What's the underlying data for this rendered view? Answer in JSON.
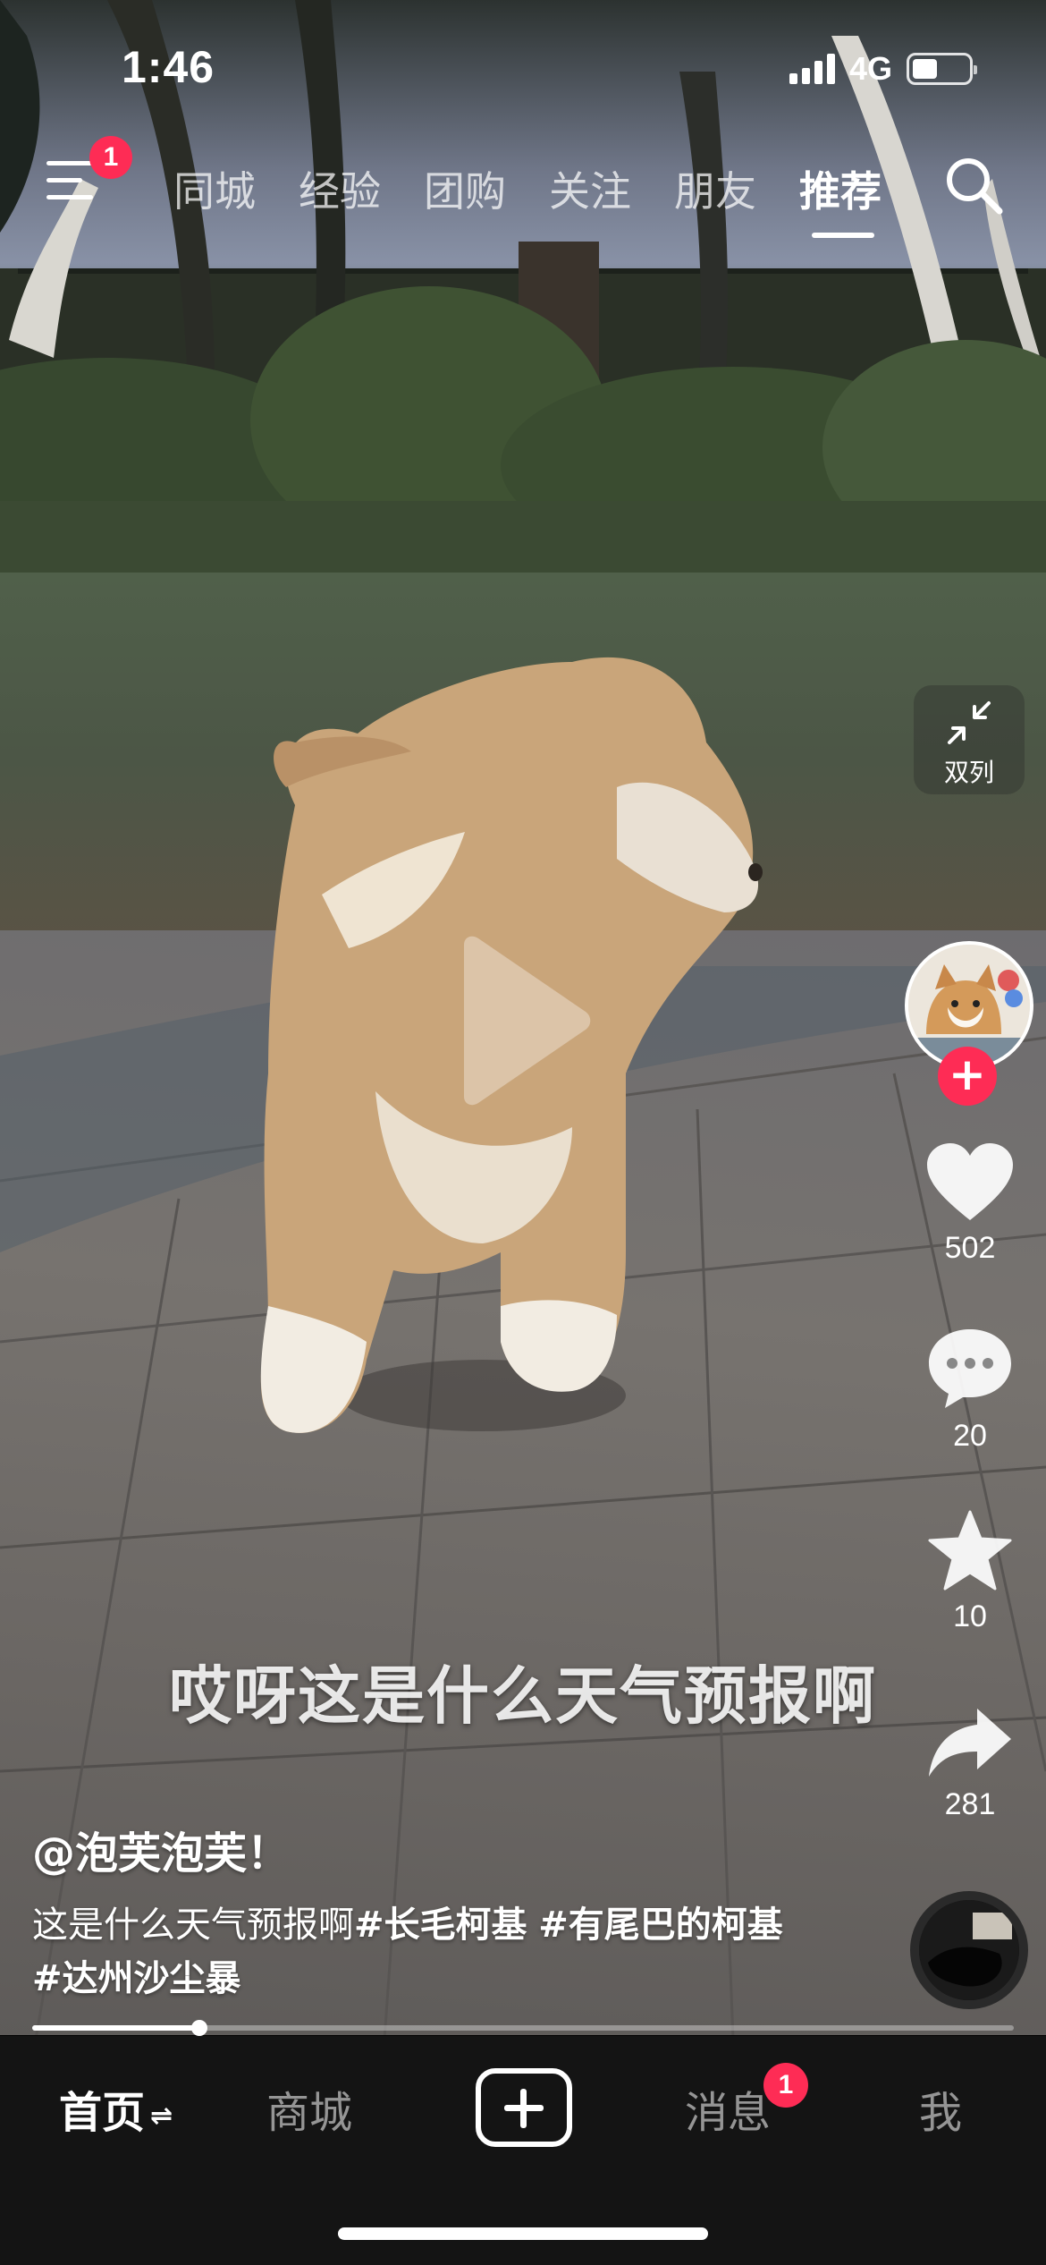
{
  "status_bar": {
    "time": "1:46",
    "network": "4G",
    "battery_level": 0.45
  },
  "top_nav": {
    "menu_badge": "1",
    "tabs": [
      {
        "label": "同城",
        "active": false
      },
      {
        "label": "经验",
        "active": false
      },
      {
        "label": "团购",
        "active": false
      },
      {
        "label": "关注",
        "active": false
      },
      {
        "label": "朋友",
        "active": false
      },
      {
        "label": "推荐",
        "active": true
      }
    ],
    "search_icon": "search-icon"
  },
  "right_rail": {
    "dual_column_label": "双列",
    "likes": "502",
    "comments": "20",
    "favorites": "10",
    "shares": "281"
  },
  "video": {
    "subtitle": "哎呀这是什么天气预报啊",
    "author": "@泡芙泡芙！",
    "caption_text": "这是什么天气预报啊",
    "hashtags": [
      "#长毛柯基",
      "#有尾巴的柯基",
      "#达州沙尘暴"
    ],
    "progress": 0.17
  },
  "bottom_nav": {
    "home": "首页",
    "mall": "商城",
    "messages": "消息",
    "messages_badge": "1",
    "me": "我"
  },
  "colors": {
    "accent": "#fe2c55",
    "bottom_bar": "#141414"
  }
}
